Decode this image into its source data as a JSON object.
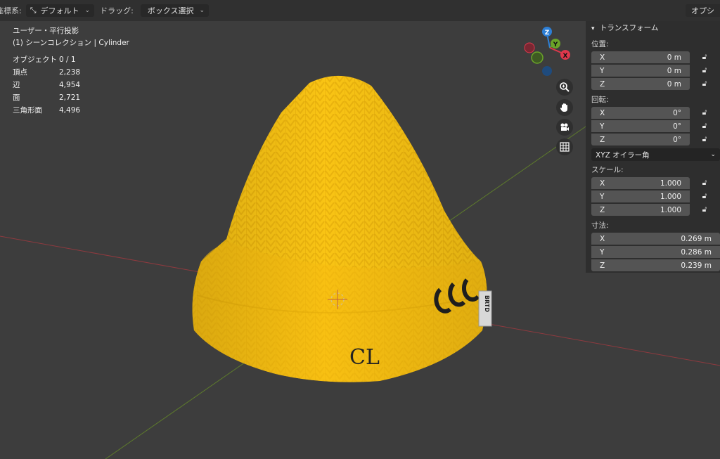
{
  "header": {
    "coord_label": "座標系:",
    "coord_value": "デフォルト",
    "drag_label": "ドラッグ:",
    "drag_value": "ボックス選択",
    "options_label": "オプシ"
  },
  "overlay": {
    "view_name": "ユーザー・平行投影",
    "collection": "(1) シーンコレクション | Cylinder",
    "stats": [
      {
        "label": "オブジェクト",
        "value": "0 / 1"
      },
      {
        "label": "頂点",
        "value": "2,238"
      },
      {
        "label": "辺",
        "value": "4,954"
      },
      {
        "label": "面",
        "value": "2,721"
      },
      {
        "label": "三角形面",
        "value": "4,496"
      }
    ]
  },
  "gizmo": {
    "z": "Z",
    "y": "Y",
    "x": "X",
    "colors": {
      "x": "#e0384c",
      "y": "#6aa428",
      "z": "#2d7fd6"
    }
  },
  "hat": {
    "logo_text": "CL",
    "tag_text": "BRTD",
    "color": "#f9c414"
  },
  "panel": {
    "title": "トランスフォーム",
    "location_label": "位置:",
    "location": [
      {
        "axis": "X",
        "value": "0 m"
      },
      {
        "axis": "Y",
        "value": "0 m"
      },
      {
        "axis": "Z",
        "value": "0 m"
      }
    ],
    "rotation_label": "回転:",
    "rotation": [
      {
        "axis": "X",
        "value": "0°"
      },
      {
        "axis": "Y",
        "value": "0°"
      },
      {
        "axis": "Z",
        "value": "0°"
      }
    ],
    "rotation_mode": "XYZ オイラー角",
    "scale_label": "スケール:",
    "scale": [
      {
        "axis": "X",
        "value": "1.000"
      },
      {
        "axis": "Y",
        "value": "1.000"
      },
      {
        "axis": "Z",
        "value": "1.000"
      }
    ],
    "dimensions_label": "寸法:",
    "dimensions": [
      {
        "axis": "X",
        "value": "0.269 m"
      },
      {
        "axis": "Y",
        "value": "0.286 m"
      },
      {
        "axis": "Z",
        "value": "0.239 m"
      }
    ]
  }
}
